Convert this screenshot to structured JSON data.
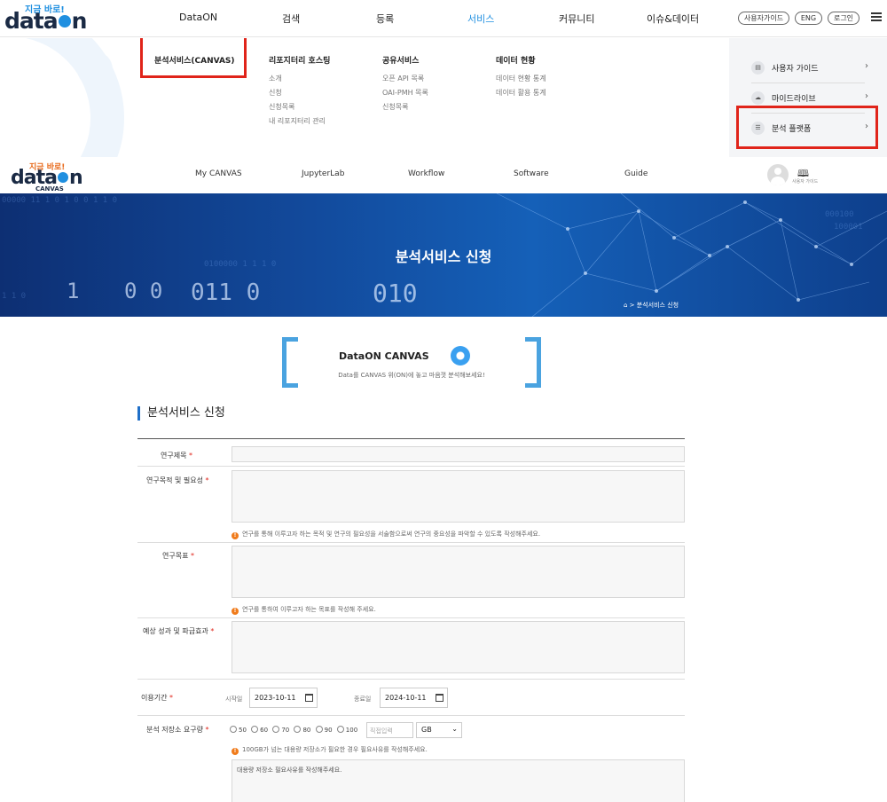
{
  "top_header": {
    "logo_tag": "지금 바로!",
    "logo_text": "data",
    "logo_text_end": "n",
    "nav": [
      "DataON",
      "검색",
      "등록",
      "서비스",
      "커뮤니티",
      "이슈&데이터"
    ],
    "nav_active_index": 3,
    "utility": [
      "사용자가이드",
      "ENG",
      "로그인"
    ]
  },
  "mega_menu": {
    "columns": [
      {
        "title": "분석서비스(CANVAS)",
        "items": []
      },
      {
        "title": "리포지터리 호스팅",
        "items": [
          "소개",
          "신청",
          "신청목록",
          "내 리포지터리 관리"
        ]
      },
      {
        "title": "공유서비스",
        "items": [
          "오픈 API 목록",
          "OAI-PMH 목록",
          "신청목록"
        ]
      },
      {
        "title": "데이터 현황",
        "items": [
          "데이터 현황 통계",
          "데이터 활용 통계"
        ]
      }
    ],
    "side": [
      {
        "label": "사용자 가이드",
        "icon": "book-icon"
      },
      {
        "label": "마이드라이브",
        "icon": "cloud-icon"
      },
      {
        "label": "분석 플랫폼",
        "icon": "list-icon"
      }
    ]
  },
  "canvas_header": {
    "logo_tag": "지금 바로!",
    "logo_text": "data",
    "logo_text_end": "n",
    "logo_sub": "CANVAS",
    "nav": [
      "My CANVAS",
      "JupyterLab",
      "Workflow",
      "Software",
      "Guide"
    ],
    "guide_label": "사용자 가이드"
  },
  "banner": {
    "title": "분석서비스 신청",
    "breadcrumb": "분석서비스 신청"
  },
  "intro": {
    "title": "DataON CANVAS",
    "description": "Data를 CANVAS 위(ON)에 놓고 마음껏 분석해보세요!"
  },
  "form": {
    "heading": "분석서비스 신청",
    "fields": {
      "title": {
        "label": "연구제목"
      },
      "purpose": {
        "label": "연구목적 및 필요성",
        "note": "연구를 통해 이루고자 하는 목적 및 연구의 필요성을 서술함으로써 연구의 중요성을 파악할 수 있도록 작성해주세요."
      },
      "goal": {
        "label": "연구목표",
        "note": "연구를 통하여 이루고자 하는 목표를 작성해 주세요."
      },
      "effect": {
        "label": "예상 성과 및 파급효과"
      },
      "period": {
        "label": "이용기간",
        "start_label": "시작일",
        "start_value": "2023-10-11",
        "end_label": "종료일",
        "end_value": "2024-10-11"
      },
      "storage": {
        "label": "분석 저장소 요구량",
        "options": [
          "50",
          "60",
          "70",
          "80",
          "90",
          "100"
        ],
        "direct_placeholder": "직접입력",
        "unit": "GB",
        "note": "100GB가 넘는 대용량 저장소가 필요한 경우 필요사유를 작성해주세요.",
        "reason_placeholder": "대용량 저장소 필요사유를 작성해주세요."
      }
    }
  },
  "colors": {
    "accent": "#1f8fe0",
    "highlight": "#e0241a",
    "note_icon": "#f07b1b"
  }
}
